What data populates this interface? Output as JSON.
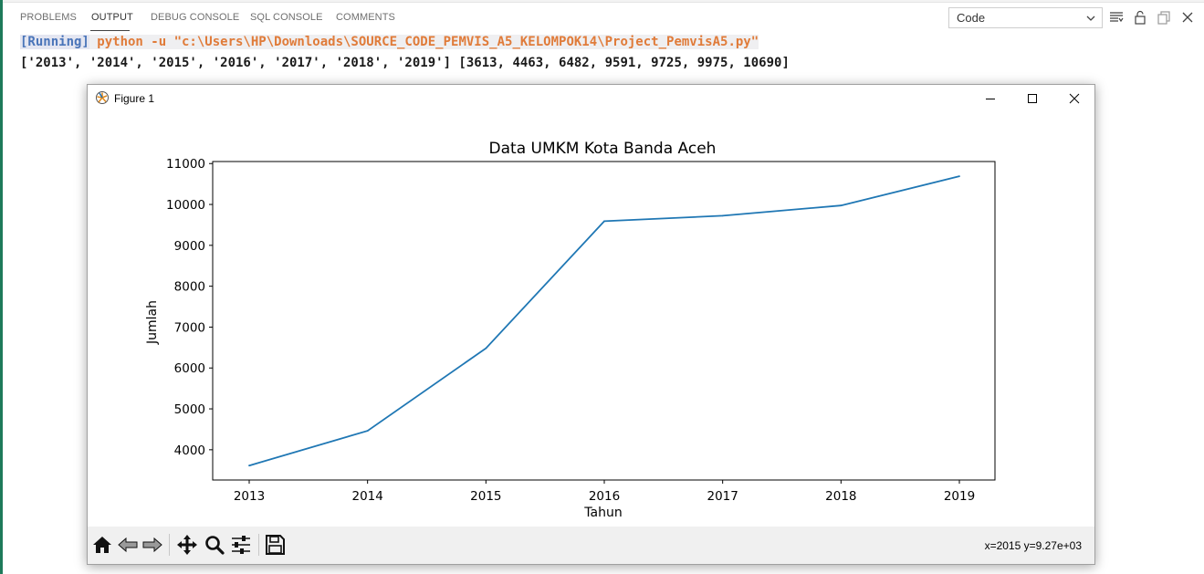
{
  "panel": {
    "tabs": [
      {
        "label": "PROBLEMS",
        "active": false
      },
      {
        "label": "OUTPUT",
        "active": true
      },
      {
        "label": "DEBUG CONSOLE",
        "active": false
      },
      {
        "label": "SQL CONSOLE",
        "active": false
      },
      {
        "label": "COMMENTS",
        "active": false
      }
    ],
    "output_channel": "Code",
    "icons": [
      "list-filter-icon",
      "lock-icon",
      "copy-icon",
      "close-icon"
    ]
  },
  "output": {
    "running_tag": "[Running]",
    "command": " python -u \"c:\\Users\\HP\\Downloads\\SOURCE_CODE_PEMVIS_A5_KELOMPOK14\\Project_PemvisA5.py\"",
    "result": "['2013', '2014', '2015', '2016', '2017', '2018', '2019'] [3613, 4463, 6482, 9591, 9725, 9975, 10690]"
  },
  "figure": {
    "window_title": "Figure 1",
    "coordinates": "x=2015 y=9.27e+03",
    "toolbar": [
      "home-icon",
      "back-icon",
      "forward-icon",
      "pan-icon",
      "zoom-icon",
      "configure-icon",
      "save-icon"
    ]
  },
  "chart_data": {
    "type": "line",
    "title": "Data UMKM Kota Banda Aceh",
    "xlabel": "Tahun",
    "ylabel": "Jumlah",
    "categories": [
      "2013",
      "2014",
      "2015",
      "2016",
      "2017",
      "2018",
      "2019"
    ],
    "values": [
      3613,
      4463,
      6482,
      9591,
      9725,
      9975,
      10690
    ],
    "yticks": [
      4000,
      5000,
      6000,
      7000,
      8000,
      9000,
      10000,
      11000
    ],
    "ylim": [
      3260,
      11050
    ],
    "grid": false,
    "line_color": "#1f77b4"
  }
}
